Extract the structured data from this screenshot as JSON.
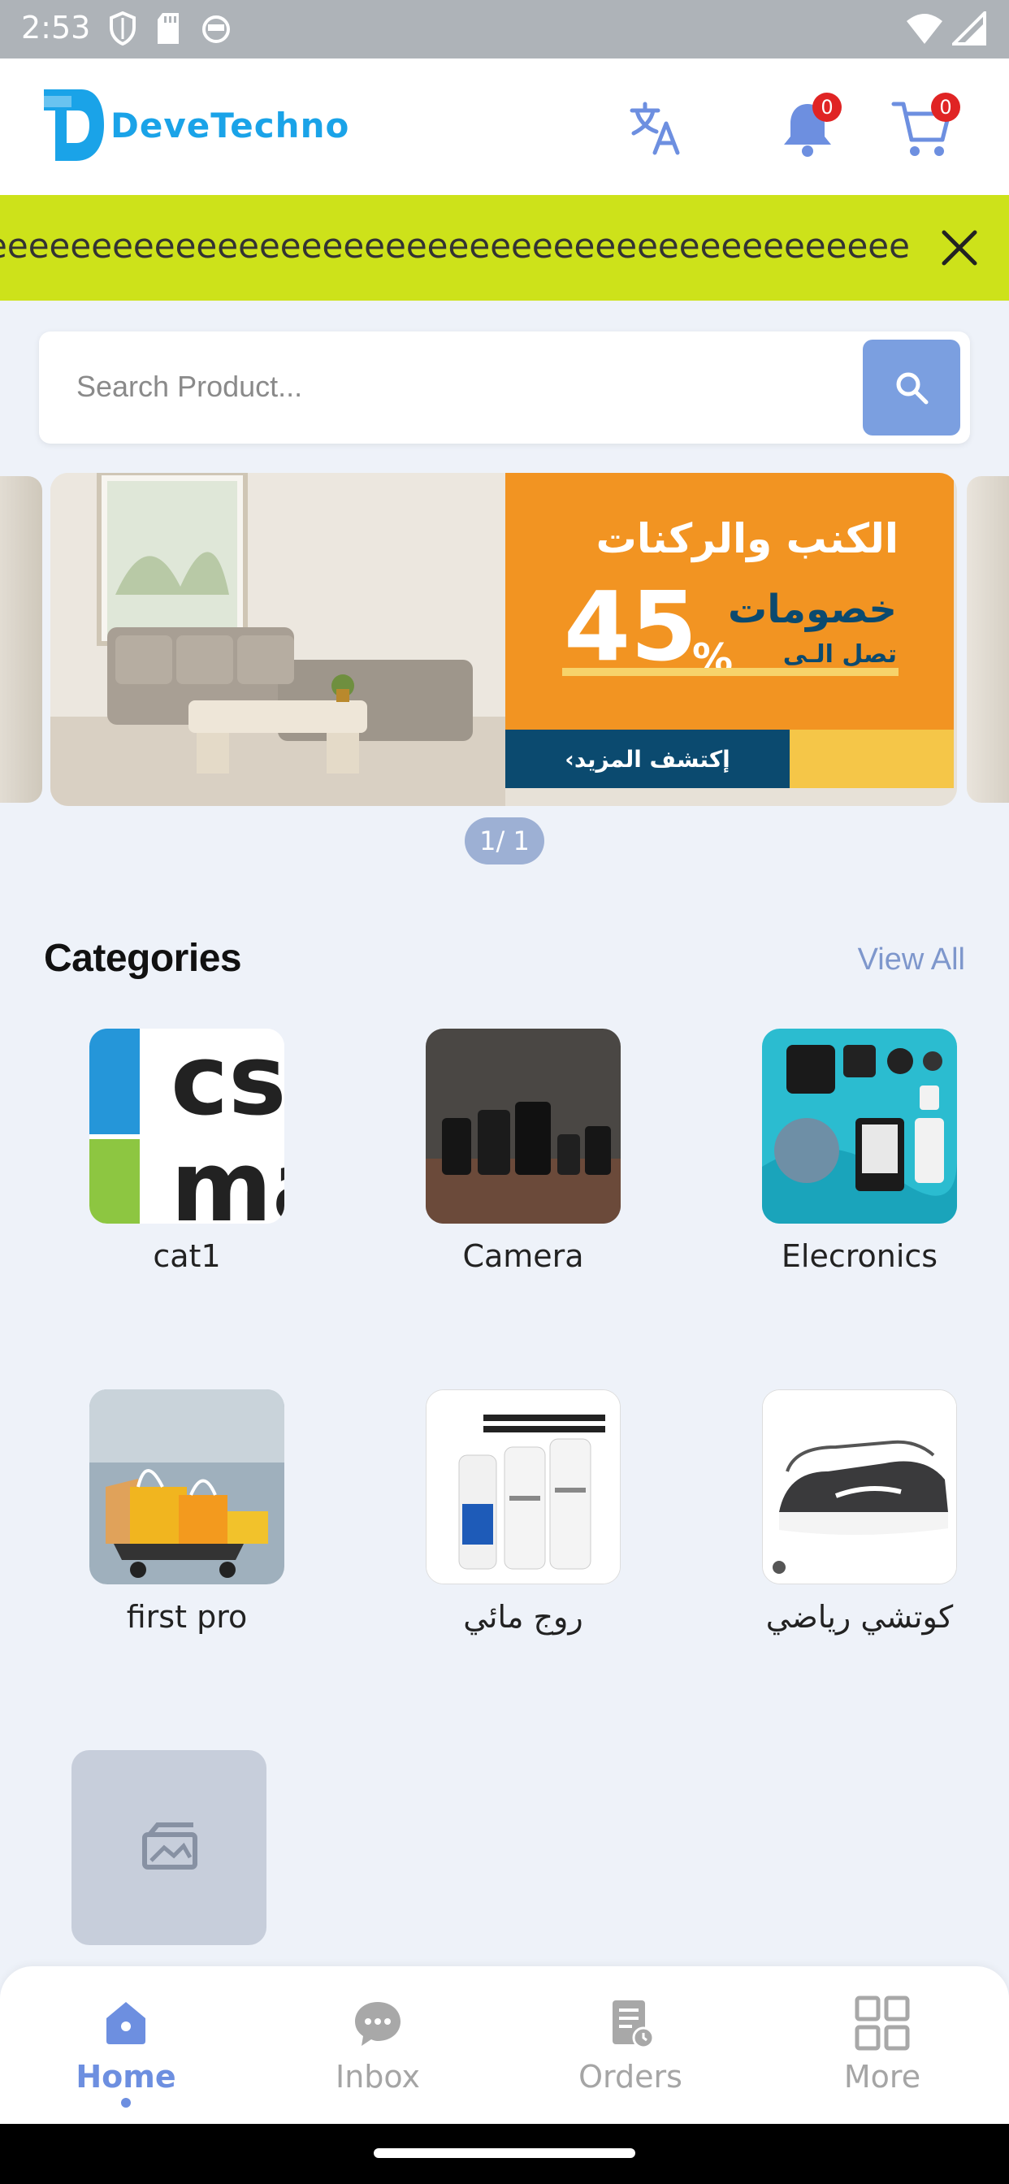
{
  "status_bar": {
    "time": "2:53"
  },
  "header": {
    "logo_text": "DeveTechno",
    "notifications_count": "0",
    "cart_count": "0"
  },
  "announcement": {
    "text": "Welcomeeeeeeeeeeeeeeeeeeeeeeeeeeeeeeeeeeeeeeeeeeeeeeeeeeeeeeeeeeeeee"
  },
  "search": {
    "placeholder": "Search Product..."
  },
  "banner": {
    "title_ar": "الكنب والركنات",
    "discount_label_ar": "خصومات",
    "upto_ar": "تصل الـى",
    "discount_value": "45",
    "discount_symbol": "%",
    "cta_ar": "إكتشف المزيد›",
    "pager": "1/ 1"
  },
  "categories": {
    "title": "Categories",
    "view_all": "View All",
    "items": [
      {
        "label": "cat1"
      },
      {
        "label": "Camera"
      },
      {
        "label": "Elecronics"
      },
      {
        "label": "first pro"
      },
      {
        "label": "روج مائي"
      },
      {
        "label": "كوتشي رياضي"
      },
      {
        "label": ""
      }
    ]
  },
  "bottom_nav": {
    "items": [
      {
        "label": "Home",
        "icon": "home-icon",
        "active": true
      },
      {
        "label": "Inbox",
        "icon": "chat-icon",
        "active": false
      },
      {
        "label": "Orders",
        "icon": "orders-icon",
        "active": false
      },
      {
        "label": "More",
        "icon": "grid-icon",
        "active": false
      }
    ]
  },
  "colors": {
    "accent": "#6d8fe0",
    "announcement_bg": "#cde21a",
    "logo": "#1aa3e8",
    "badge": "#e02424"
  }
}
